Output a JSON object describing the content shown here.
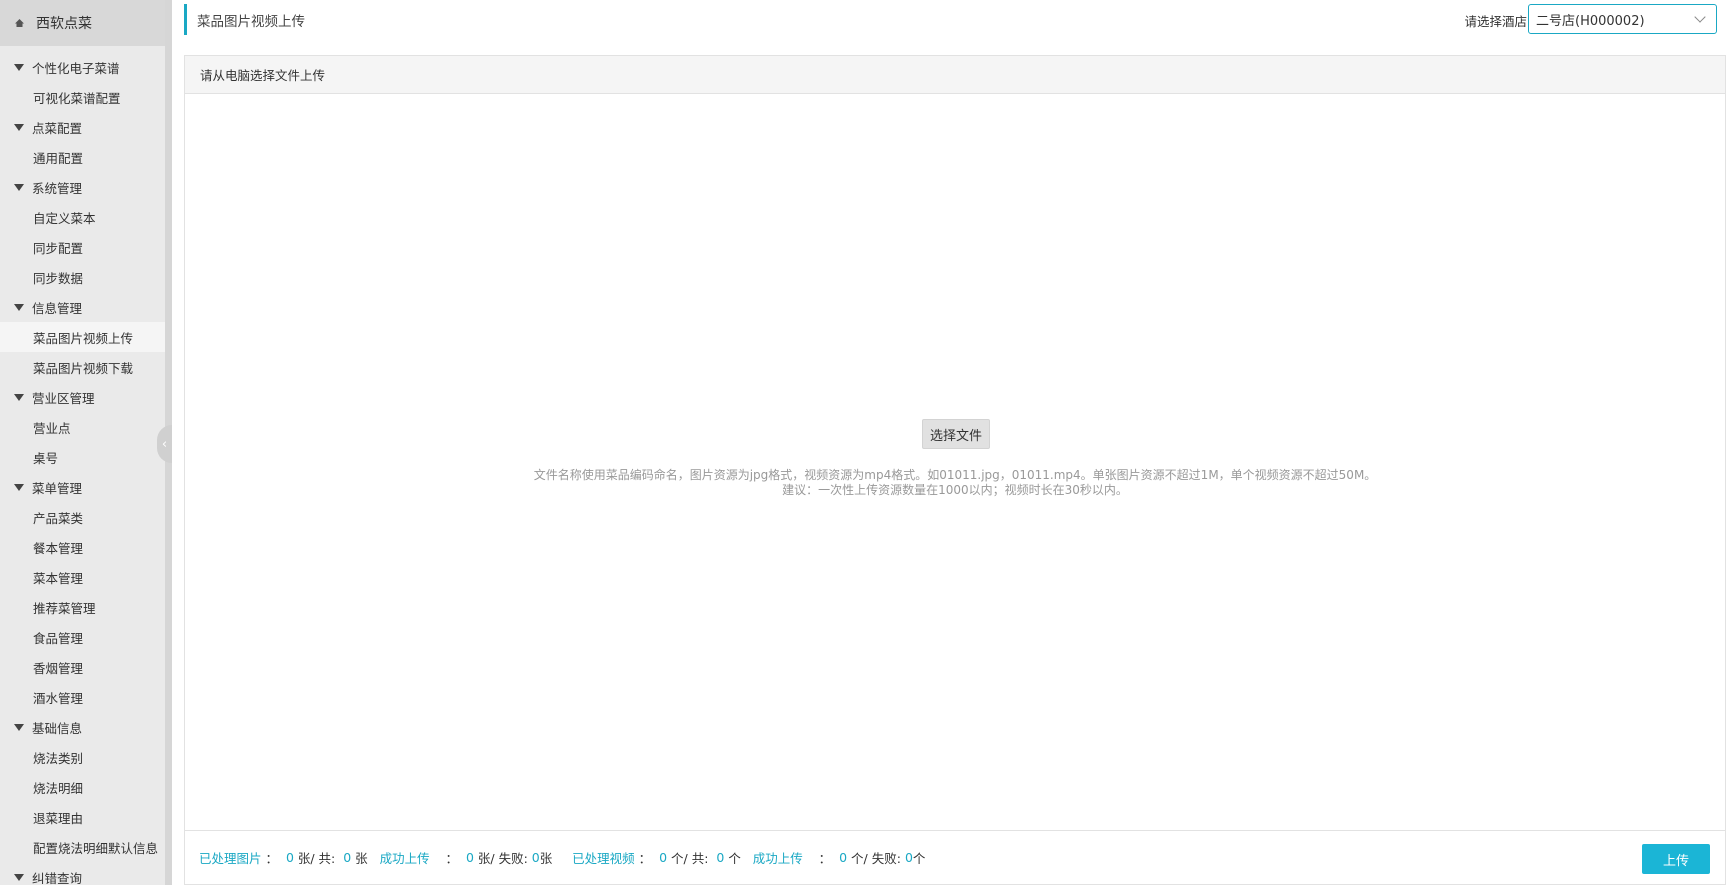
{
  "app": {
    "title": "西软点菜"
  },
  "sidebar": {
    "groups": [
      {
        "label": "个性化电子菜谱",
        "items": [
          "可视化菜谱配置"
        ]
      },
      {
        "label": "点菜配置",
        "items": [
          "通用配置"
        ]
      },
      {
        "label": "系统管理",
        "items": [
          "自定义菜本",
          "同步配置",
          "同步数据"
        ]
      },
      {
        "label": "信息管理",
        "items": [
          "菜品图片视频上传",
          "菜品图片视频下载"
        ]
      },
      {
        "label": "营业区管理",
        "items": [
          "营业点",
          "桌号"
        ]
      },
      {
        "label": "菜单管理",
        "items": [
          "产品菜类",
          "餐本管理",
          "菜本管理",
          "推荐菜管理",
          "食品管理",
          "香烟管理",
          "酒水管理"
        ]
      },
      {
        "label": "基础信息",
        "items": [
          "烧法类别",
          "烧法明细",
          "退菜理由",
          "配置烧法明细默认信息"
        ]
      },
      {
        "label": "纠错查询",
        "items": []
      }
    ],
    "active_item": "菜品图片视频上传"
  },
  "header": {
    "page_title": "菜品图片视频上传",
    "hotel_label": "请选择酒店",
    "hotel_selected": "二号店(H000002)"
  },
  "panel": {
    "heading": "请从电脑选择文件上传",
    "choose_button": "选择文件",
    "hint_line1": "文件名称使用菜品编码命名，图片资源为jpg格式，视频资源为mp4格式。如01011.jpg，01011.mp4。单张图片资源不超过1M，单个视频资源不超过50M。",
    "hint_line2": "建议：一次性上传资源数量在1000以内；视频时长在30秒以内。"
  },
  "footer": {
    "processed_images_label": "已处理图片",
    "processed_images": "0",
    "images_total_sep": "张/ 共:",
    "images_total": "0",
    "images_unit": "张",
    "images_success_label": "成功上传",
    "images_success": "0",
    "images_fail_sep": "张/ 失败:",
    "images_fail": "0",
    "images_fail_unit": "张",
    "processed_videos_label": "已处理视频",
    "processed_videos": "0",
    "videos_total_sep": "个/ 共:",
    "videos_total": "0",
    "videos_unit": "个",
    "videos_success_label": "成功上传",
    "videos_success": "0",
    "videos_fail_sep": "个/ 失败:",
    "videos_fail": "0",
    "videos_fail_unit": "个",
    "upload_button": "上传"
  },
  "colors": {
    "accent": "#1aa8c4",
    "upload_button": "#1bb5d6",
    "sidebar_bg": "#eaeaea"
  }
}
